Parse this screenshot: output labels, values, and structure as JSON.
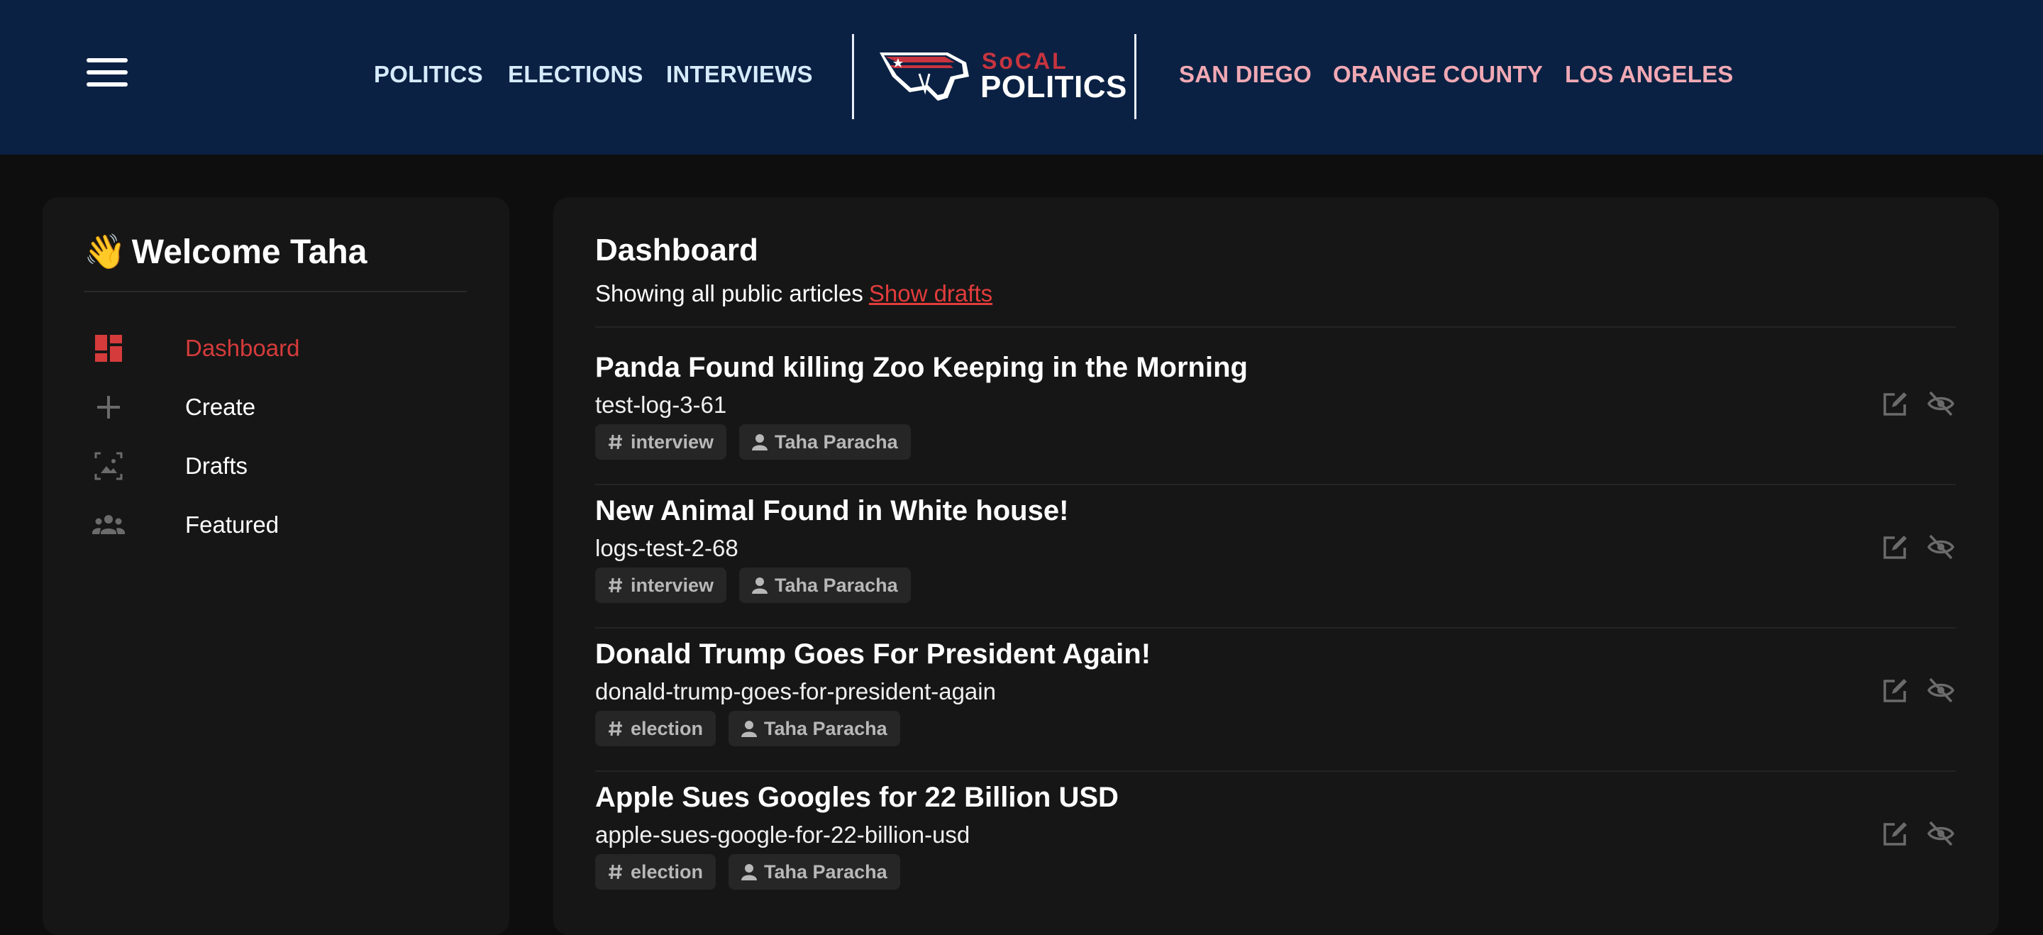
{
  "header": {
    "nav_left": [
      "POLITICS",
      "ELECTIONS",
      "INTERVIEWS"
    ],
    "nav_right": [
      "SAN DIEGO",
      "ORANGE COUNTY",
      "LOS ANGELES"
    ],
    "logo": {
      "top": "SoCAL",
      "bottom": "POLITICS"
    }
  },
  "sidebar": {
    "wave": "👋",
    "welcome": "Welcome Taha",
    "items": [
      {
        "label": "Dashboard",
        "icon": "dashboard-icon",
        "active": true
      },
      {
        "label": "Create",
        "icon": "plus-icon"
      },
      {
        "label": "Drafts",
        "icon": "drafts-icon"
      },
      {
        "label": "Featured",
        "icon": "group-icon"
      }
    ]
  },
  "main": {
    "title": "Dashboard",
    "subtitle": "Showing all public articles",
    "show_drafts": "Show drafts",
    "articles": [
      {
        "title": "Panda Found killing Zoo Keeping in the Morning",
        "slug": "test-log-3-61",
        "tag": "interview",
        "author": "Taha Paracha"
      },
      {
        "title": "New Animal Found in White house!",
        "slug": "logs-test-2-68",
        "tag": "interview",
        "author": "Taha Paracha"
      },
      {
        "title": "Donald Trump Goes For President Again!",
        "slug": "donald-trump-goes-for-president-again",
        "tag": "election",
        "author": "Taha Paracha"
      },
      {
        "title": "Apple Sues Googles for 22 Billion USD",
        "slug": "apple-sues-google-for-22-billion-usd",
        "tag": "election",
        "author": "Taha Paracha"
      }
    ]
  },
  "colors": {
    "header_bg": "#0b2143",
    "nav_left": "#d6ebfb",
    "nav_right": "#f1a9b4",
    "accent_red": "#d63b3b",
    "panel_bg": "#161616",
    "page_bg": "#0e0e0e"
  }
}
